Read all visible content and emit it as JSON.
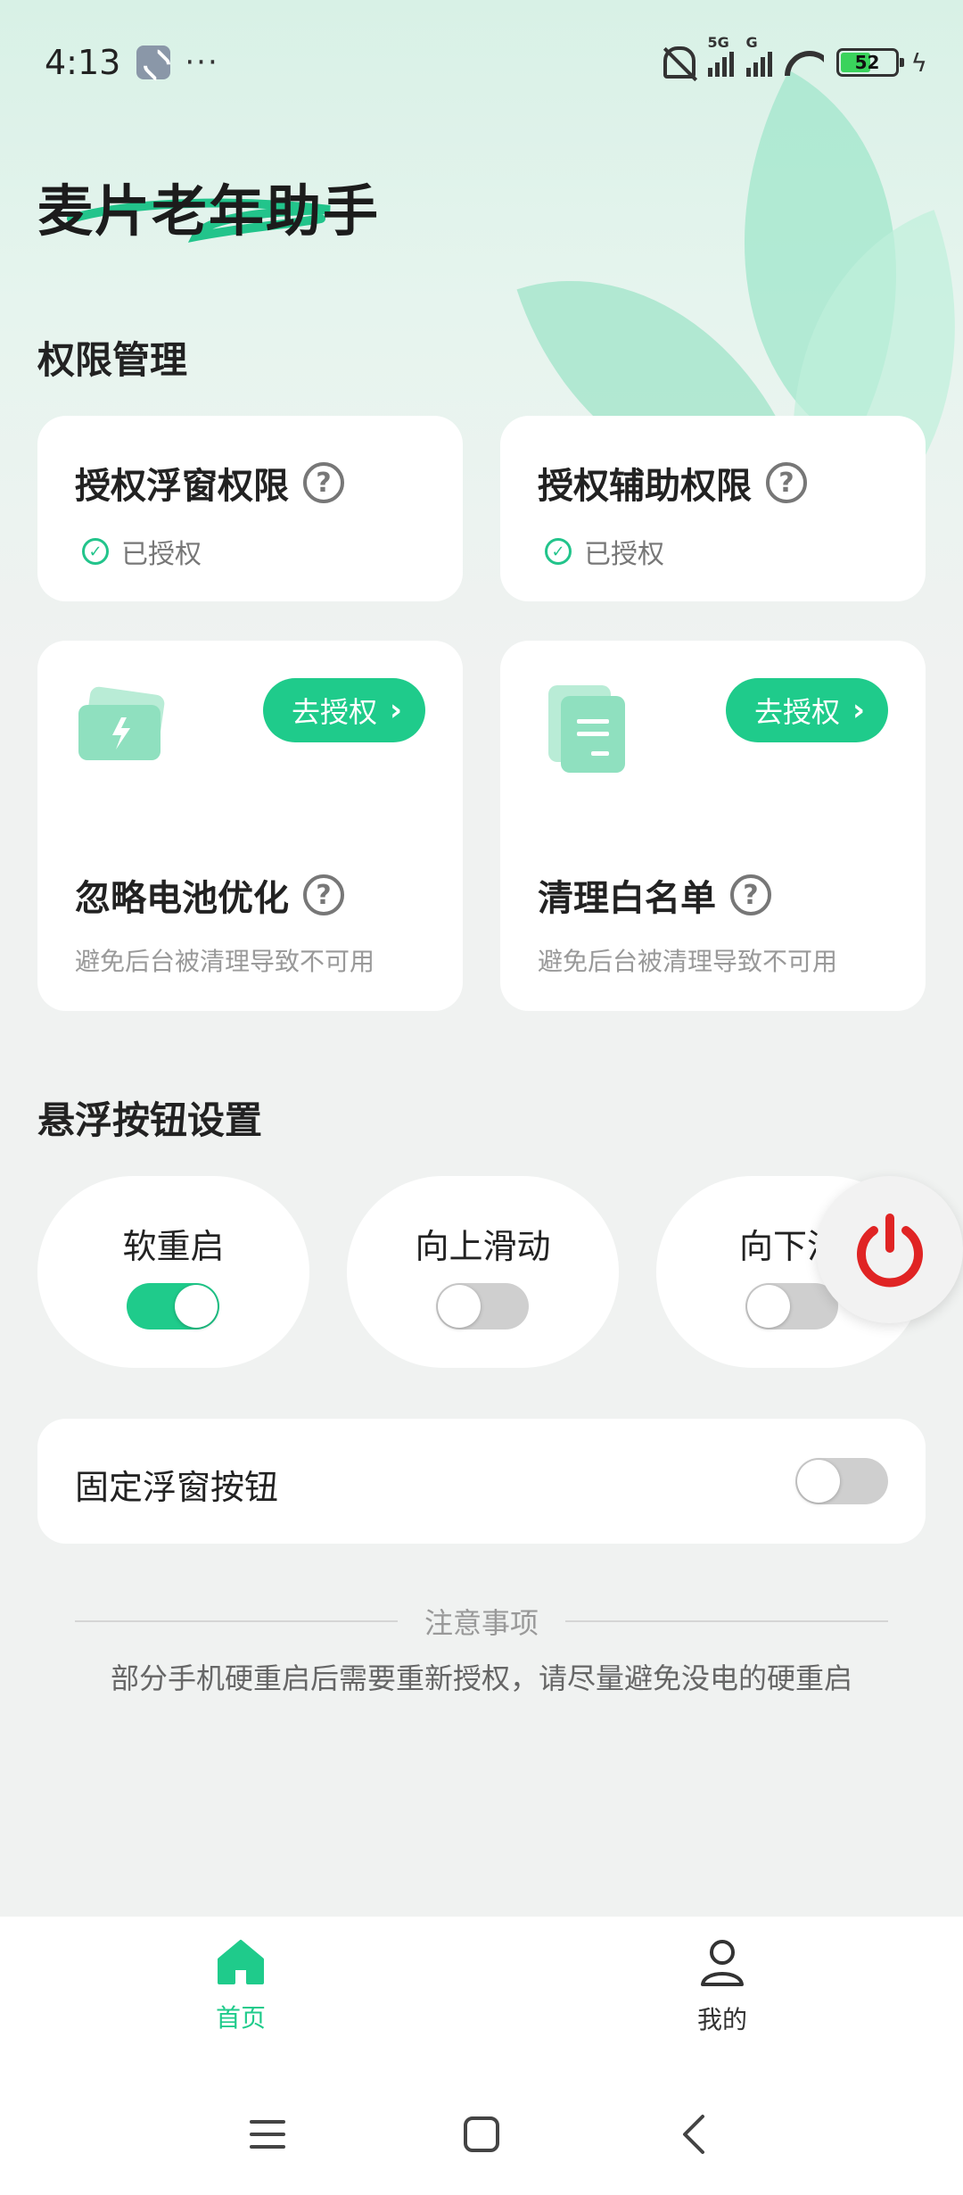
{
  "status_bar": {
    "time": "4:13",
    "more": "···",
    "signal_1_tag": "5G",
    "signal_2_tag": "G",
    "battery_level": "52"
  },
  "app": {
    "title": "麦片老年助手",
    "accent_color": "#1fcb8b"
  },
  "permissions": {
    "section_title": "权限管理",
    "overlay": {
      "title": "授权浮窗权限",
      "status": "已授权"
    },
    "accessibility": {
      "title": "授权辅助权限",
      "status": "已授权"
    },
    "battery": {
      "button": "去授权",
      "title": "忽略电池优化",
      "desc": "避免后台被清理导致不可用"
    },
    "whitelist": {
      "button": "去授权",
      "title": "清理白名单",
      "desc": "避免后台被清理导致不可用"
    },
    "help_mark": "?"
  },
  "float_settings": {
    "section_title": "悬浮按钮设置",
    "toggles": [
      {
        "label": "软重启",
        "on": true
      },
      {
        "label": "向上滑动",
        "on": false
      },
      {
        "label": "向下滑",
        "on": false
      }
    ],
    "fixed": {
      "label": "固定浮窗按钮",
      "on": false
    }
  },
  "notice": {
    "title": "注意事项",
    "text": "部分手机硬重启后需要重新授权，请尽量避免没电的硬重启"
  },
  "bottom_nav": {
    "items": [
      {
        "label": "首页",
        "icon": "home-icon",
        "active": true
      },
      {
        "label": "我的",
        "icon": "person-icon",
        "active": false
      }
    ]
  }
}
